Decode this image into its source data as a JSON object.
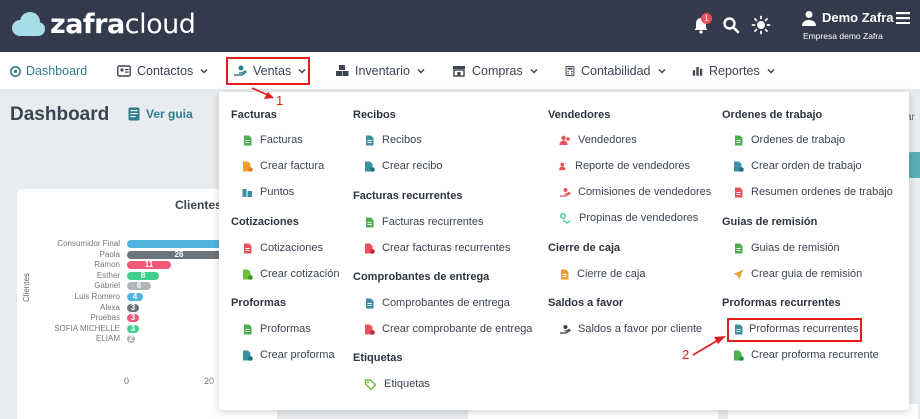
{
  "brand": {
    "name_bold": "zafra",
    "name_light": "cloud"
  },
  "header": {
    "notification_count": "1",
    "user_name": "Demo Zafra",
    "company": "Empresa demo Zafra"
  },
  "nav": {
    "dashboard": "Dashboard",
    "contactos": "Contactos",
    "ventas": "Ventas",
    "inventario": "Inventario",
    "compras": "Compras",
    "contabilidad": "Contabilidad",
    "reportes": "Reportes"
  },
  "page": {
    "title": "Dashboard",
    "guide": "Ver guia",
    "edge_text": "ar"
  },
  "chart_data": {
    "type": "bar",
    "title": "Clientes",
    "ylabel": "Clientes",
    "categories": [
      "Consumidor Final",
      "Paola",
      "Ramon",
      "Esther",
      "Gabriel",
      "Luis Romero",
      "Alexa",
      "Pruebas",
      "SOFIA MICHELLE",
      "ELIAM"
    ],
    "values": [
      40,
      26,
      11,
      8,
      6,
      4,
      3,
      3,
      3,
      2
    ],
    "data_labels": [
      "",
      "26",
      "11",
      "8",
      "6",
      "4",
      "3",
      "3",
      "3",
      "2"
    ],
    "colors": [
      "#4fb4e0",
      "#6c757d",
      "#f0587a",
      "#3ecf8e",
      "#adb5bd",
      "#4fb4e0",
      "#6c757d",
      "#f0587a",
      "#3ecf8e",
      "#adb5bd"
    ],
    "xticks": [
      "0",
      "20"
    ],
    "xlim": [
      0,
      40
    ]
  },
  "menu": {
    "col1": {
      "facturas_title": "Facturas",
      "facturas": "Facturas",
      "crear_factura": "Crear factura",
      "puntos": "Puntos",
      "cotizaciones_title": "Cotizaciones",
      "cotizaciones": "Cotizaciones",
      "crear_cotizacion": "Crear cotización",
      "proformas_title": "Proformas",
      "proformas": "Proformas",
      "crear_proforma": "Crear proforma"
    },
    "col2": {
      "recibos_title": "Recibos",
      "recibos": "Recibos",
      "crear_recibo": "Crear recibo",
      "fact_rec_title": "Facturas recurrentes",
      "fact_rec": "Facturas recurrentes",
      "crear_fact_rec": "Crear facturas recurrentes",
      "comp_title": "Comprobantes de entrega",
      "comp": "Comprobantes de entrega",
      "crear_comp": "Crear comprobante de entrega",
      "etiquetas_title": "Etiquetas",
      "etiquetas": "Etiquetas"
    },
    "col3": {
      "vendedores_title": "Vendedores",
      "vendedores": "Vendedores",
      "reporte_vendedores": "Reporte de vendedores",
      "comisiones": "Comisiones de vendedores",
      "propinas": "Propinas de vendedores",
      "cierre_title": "Cierre de caja",
      "cierre": "Cierre de caja",
      "saldos_title": "Saldos a favor",
      "saldos": "Saldos a favor por cliente"
    },
    "col4": {
      "ordenes_title": "Ordenes de trabajo",
      "ordenes": "Ordenes de trabajo",
      "crear_orden": "Crear orden de trabajo",
      "resumen_ordenes": "Resumen ordenes de trabajo",
      "guias_title": "Guias de remisión",
      "guias": "Guias de remisión",
      "crear_guia": "Crear guia de remisión",
      "prof_rec_title": "Proformas recurrentes",
      "prof_rec": "Proformas recurrentes",
      "crear_prof_rec": "Crear proforma recurrente"
    }
  },
  "annotations": {
    "step1": "1",
    "step2": "2"
  },
  "colors": {
    "topbar": "#343a4b",
    "accent": "#2f7d8c",
    "annotation": "#e11d1d"
  }
}
